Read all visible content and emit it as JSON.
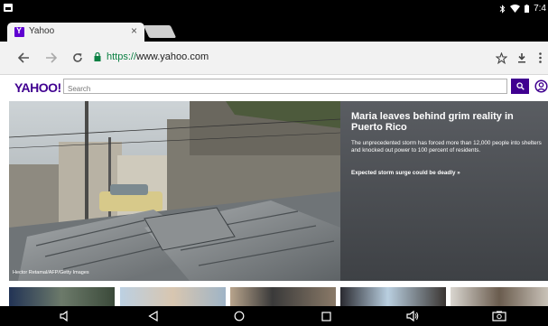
{
  "browser": {
    "tab": {
      "title": "Yahoo",
      "close": "×"
    },
    "url": {
      "scheme": "https://",
      "host": "www.yahoo.com"
    }
  },
  "status_bar": {
    "time": "7:4"
  },
  "yahoo": {
    "logo": "YAHOO!",
    "search_placeholder": "Search"
  },
  "hero": {
    "credit": "Hector Retamal/AFP/Getty Images",
    "headline": "Maria leaves behind grim reality in Puerto Rico",
    "summary": "The unprecedented storm has forced more than 12,000 people into shelters and knocked out power to 100 percent of residents.",
    "related": "Expected storm surge could be deadly »"
  },
  "colors": {
    "brand": "#400090",
    "secure": "#0b8043",
    "hero_panel": "#4a4e53"
  },
  "thumbnails": [
    "thumb-1",
    "thumb-2",
    "thumb-3",
    "thumb-4",
    "thumb-5"
  ],
  "nav_icons": [
    "volume-down-icon",
    "back-icon",
    "home-icon",
    "recents-icon",
    "volume-up-icon",
    "screenshot-icon"
  ]
}
